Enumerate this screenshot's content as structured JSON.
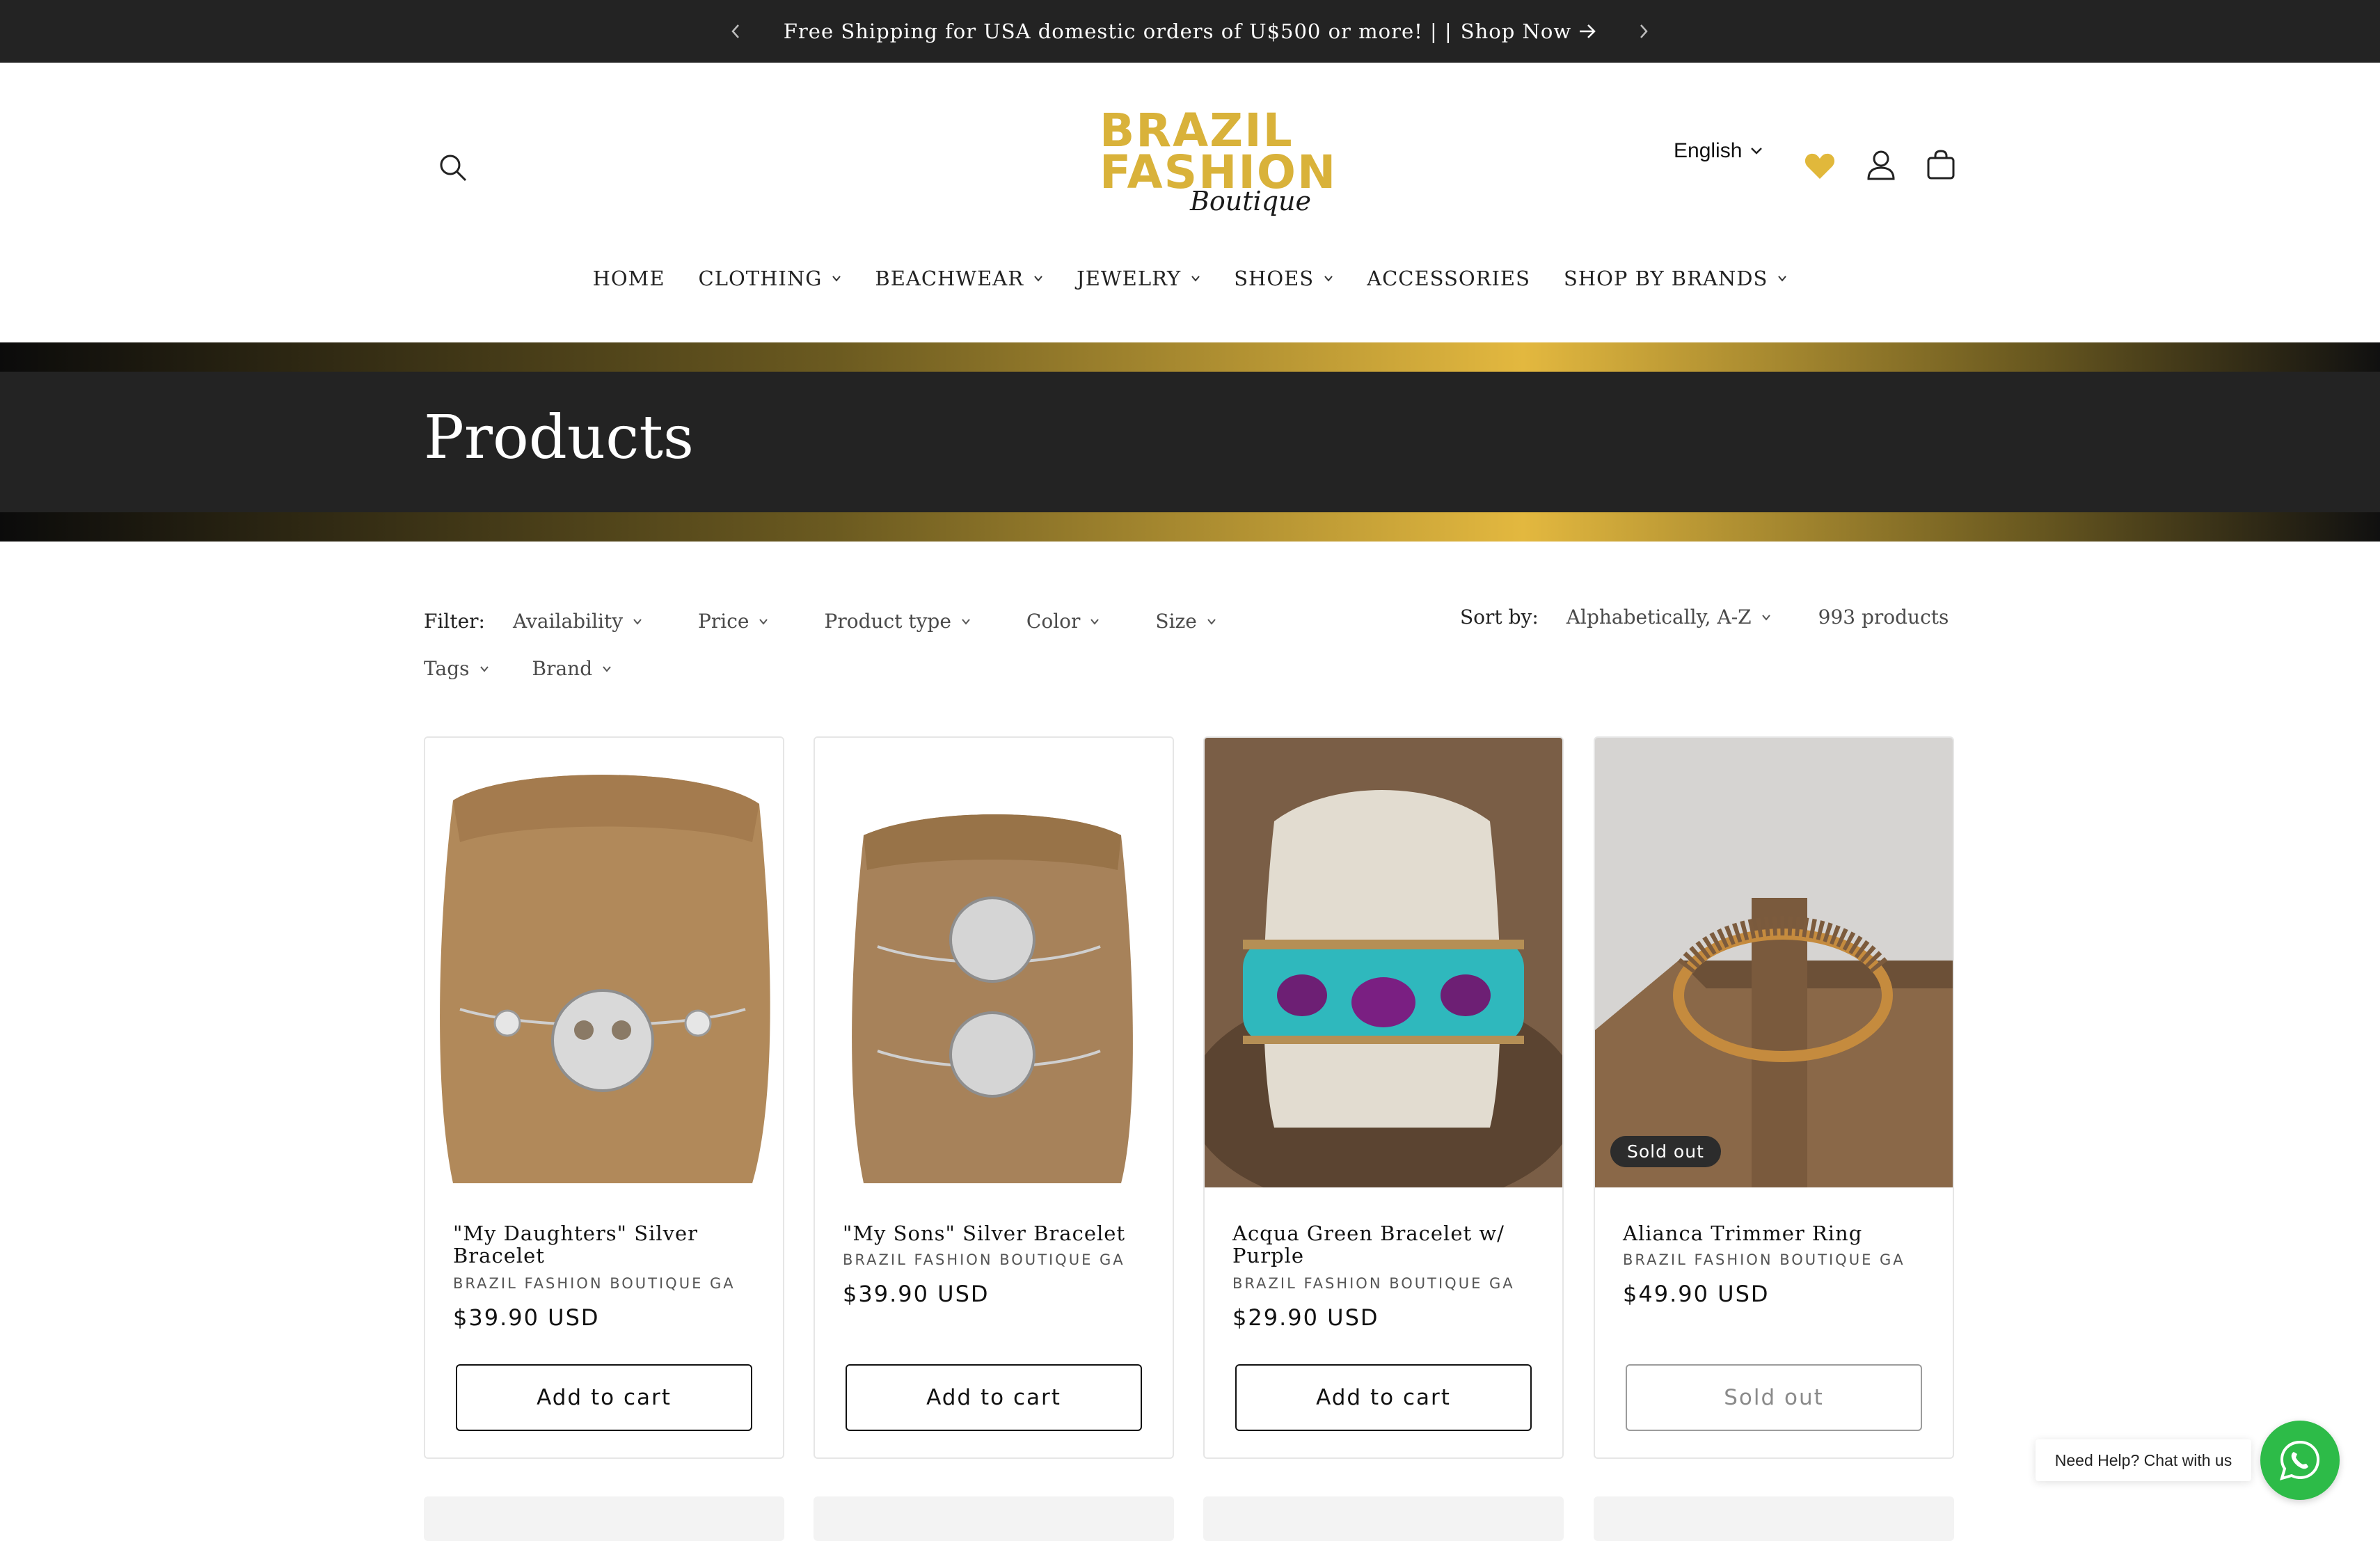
{
  "announcement": {
    "text": "Free Shipping for USA domestic orders of U$500 or more! | |",
    "link_text": "Shop Now"
  },
  "header": {
    "logo": {
      "line1": "BRAZIL",
      "line2": "FASHION",
      "line3": "Boutique"
    },
    "language": "English",
    "nav": [
      "HOME",
      "CLOTHING",
      "BEACHWEAR",
      "JEWELRY",
      "SHOES",
      "ACCESSORIES",
      "SHOP BY BRANDS"
    ],
    "accent_color": "#e1b83b"
  },
  "page": {
    "title": "Products"
  },
  "filters": {
    "label": "Filter:",
    "items": [
      "Availability",
      "Price",
      "Product type",
      "Color",
      "Size",
      "Tags",
      "Brand"
    ],
    "sort_label": "Sort by:",
    "sort_value": "Alphabetically, A-Z",
    "product_count": "993 products"
  },
  "products": [
    {
      "title": "\"My Daughters\" Silver Bracelet",
      "vendor": "BRAZIL FASHION BOUTIQUE GA",
      "price": "$39.90 USD",
      "button": "Add to cart",
      "badge": ""
    },
    {
      "title": "\"My Sons\" Silver Bracelet",
      "vendor": "BRAZIL FASHION BOUTIQUE GA",
      "price": "$39.90 USD",
      "button": "Add to cart",
      "badge": ""
    },
    {
      "title": "Acqua Green Bracelet w/ Purple",
      "vendor": "BRAZIL FASHION BOUTIQUE GA",
      "price": "$29.90 USD",
      "button": "Add to cart",
      "badge": ""
    },
    {
      "title": "Alianca Trimmer Ring",
      "vendor": "BRAZIL FASHION BOUTIQUE GA",
      "price": "$49.90 USD",
      "button": "Sold out",
      "badge": "Sold out"
    }
  ],
  "chat": {
    "text": "Need Help? Chat with us",
    "color": "#2dbb48"
  }
}
